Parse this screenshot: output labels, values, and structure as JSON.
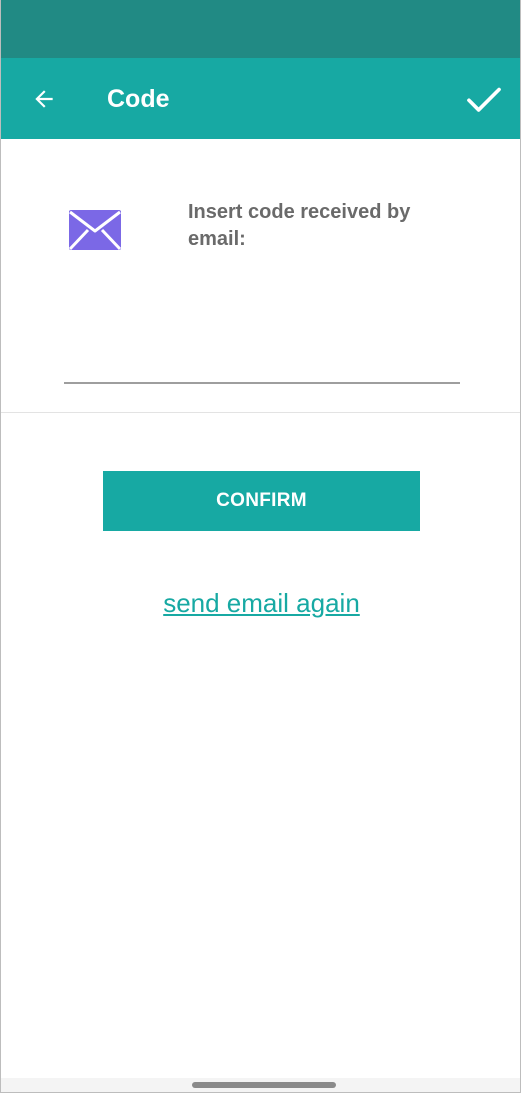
{
  "header": {
    "title": "Code"
  },
  "prompt": {
    "text": "Insert code received by email:"
  },
  "code_input": {
    "value": "",
    "placeholder": ""
  },
  "actions": {
    "confirm_label": "CONFIRM",
    "resend_label": "send email again"
  },
  "icons": {
    "back": "arrow-left-icon",
    "confirm": "check-icon",
    "mail": "envelope-icon"
  },
  "colors": {
    "status_bar": "#218a84",
    "primary": "#17a9a3",
    "mail_icon": "#7b68e6",
    "prompt_text": "#6a6a6a"
  }
}
